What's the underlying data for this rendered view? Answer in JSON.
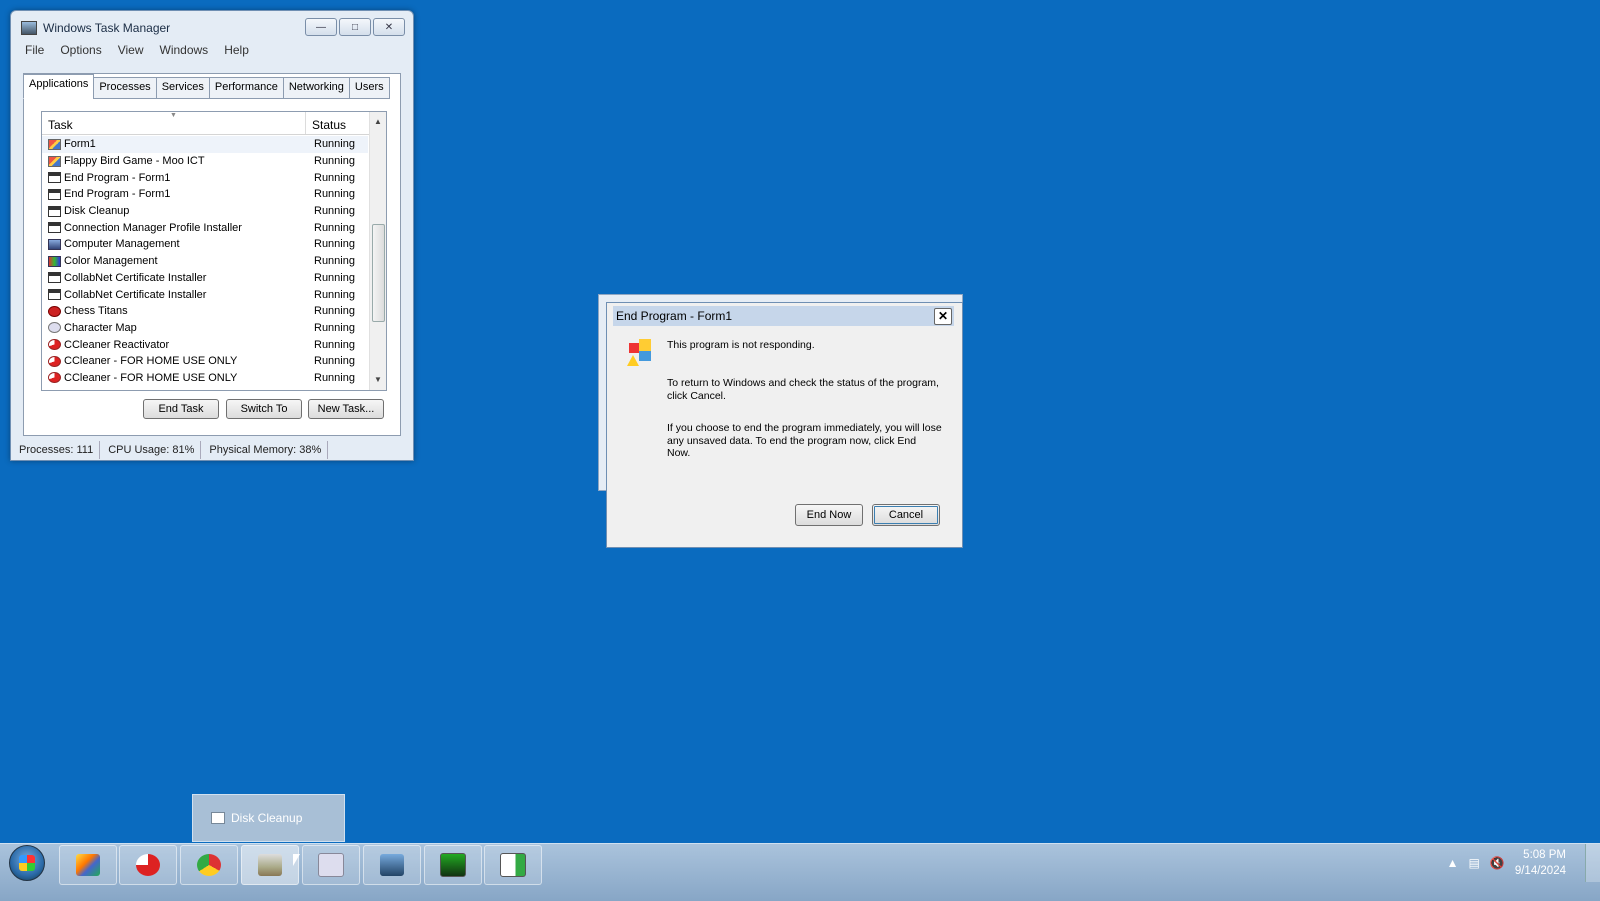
{
  "taskmgr": {
    "title": "Windows Task Manager",
    "menu": [
      "File",
      "Options",
      "View",
      "Windows",
      "Help"
    ],
    "tabs": [
      "Applications",
      "Processes",
      "Services",
      "Performance",
      "Networking",
      "Users"
    ],
    "active_tab": "Applications",
    "columns": {
      "task": "Task",
      "status": "Status"
    },
    "rows": [
      {
        "task": "Form1",
        "status": "Running",
        "icon": "app-icon"
      },
      {
        "task": "Flappy Bird Game - Moo ICT",
        "status": "Running",
        "icon": "app-icon"
      },
      {
        "task": "End Program - Form1",
        "status": "Running",
        "icon": "window-icon"
      },
      {
        "task": "End Program - Form1",
        "status": "Running",
        "icon": "window-icon"
      },
      {
        "task": "Disk Cleanup",
        "status": "Running",
        "icon": "window-icon"
      },
      {
        "task": "Connection Manager Profile Installer",
        "status": "Running",
        "icon": "window-icon"
      },
      {
        "task": "Computer Management",
        "status": "Running",
        "icon": "computer-management-icon"
      },
      {
        "task": "Color Management",
        "status": "Running",
        "icon": "color-management-icon"
      },
      {
        "task": "CollabNet Certificate Installer",
        "status": "Running",
        "icon": "window-icon"
      },
      {
        "task": "CollabNet Certificate Installer",
        "status": "Running",
        "icon": "window-icon"
      },
      {
        "task": "Chess Titans",
        "status": "Running",
        "icon": "chess-icon"
      },
      {
        "task": "Character Map",
        "status": "Running",
        "icon": "character-map-icon"
      },
      {
        "task": "CCleaner Reactivator",
        "status": "Running",
        "icon": "ccleaner-icon"
      },
      {
        "task": "CCleaner - FOR HOME USE ONLY",
        "status": "Running",
        "icon": "ccleaner-icon"
      },
      {
        "task": "CCleaner - FOR HOME USE ONLY",
        "status": "Running",
        "icon": "ccleaner-icon"
      }
    ],
    "buttons": {
      "end_task": "End Task",
      "switch_to": "Switch To",
      "new_task": "New Task..."
    },
    "statusbar": {
      "processes": "Processes: 111",
      "cpu": "CPU Usage: 81%",
      "memory": "Physical Memory: 38%"
    }
  },
  "dialog": {
    "title": "End Program - Form1",
    "line1": "This program is not responding.",
    "line2": "To return to Windows and check the status of the program, click Cancel.",
    "line3": "If you choose to end the program immediately, you will lose any unsaved data. To end the program now, click End Now.",
    "end_now": "End Now",
    "cancel": "Cancel"
  },
  "taskbar": {
    "preview_label": "Disk Cleanup",
    "time": "5:08 PM",
    "date": "9/14/2024",
    "pinned": [
      "monitor-app-icon",
      "ccleaner-icon",
      "chrome-icon",
      "disk-cleanup-icon",
      "character-map-icon",
      "computer-management-icon",
      "task-manager-icon",
      "form-app-icon"
    ],
    "active_index": 3
  },
  "colors": {
    "desktop": "#0a6bbf",
    "taskbar": "#9bb6d2"
  }
}
